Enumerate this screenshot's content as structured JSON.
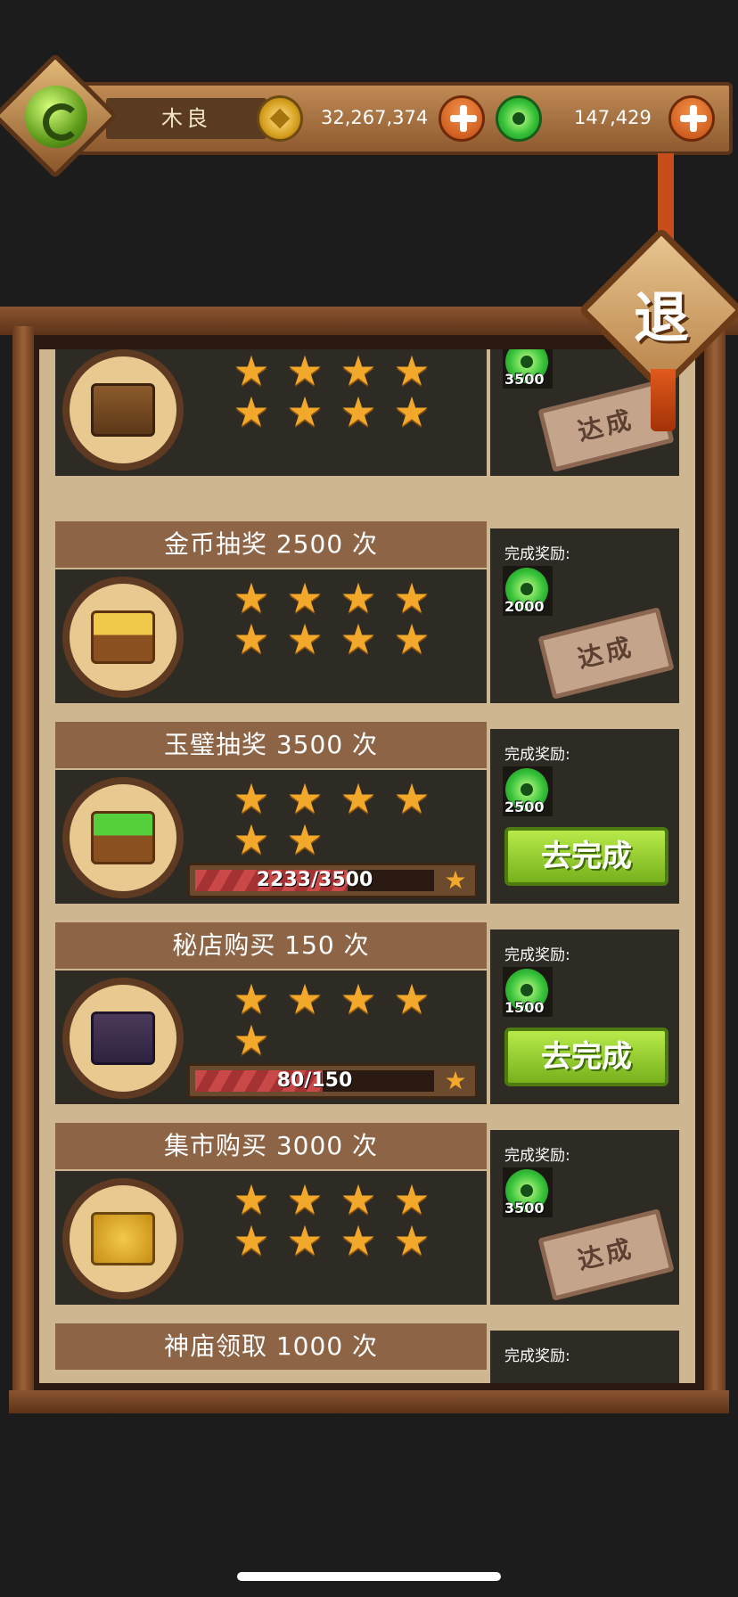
{
  "header": {
    "player_name": "木良",
    "gold": "32,267,374",
    "jade": "147,429"
  },
  "exit_label": "退",
  "tasks": [
    {
      "title": "",
      "stars_earned": 8,
      "stars_total": 8,
      "reward_label": "",
      "reward_amount": "3500",
      "status": "达成",
      "icon": "mahjong-chest-icon"
    },
    {
      "title": "金币抽奖 2500 次",
      "stars_earned": 8,
      "stars_total": 8,
      "reward_label": "完成奖励:",
      "reward_amount": "2000",
      "status": "达成",
      "icon": "gold-chest-icon"
    },
    {
      "title": "玉璧抽奖 3500 次",
      "stars_earned": 6,
      "stars_total": 8,
      "reward_label": "完成奖励:",
      "reward_amount": "2500",
      "progress_text": "2233/3500",
      "progress": 0.638,
      "action": "去完成",
      "icon": "jade-chest-icon"
    },
    {
      "title": "秘店购买 150 次",
      "stars_earned": 5,
      "stars_total": 8,
      "reward_label": "完成奖励:",
      "reward_amount": "1500",
      "progress_text": "80/150",
      "progress": 0.533,
      "action": "去完成",
      "icon": "secret-shop-icon"
    },
    {
      "title": "集市购买 3000 次",
      "stars_earned": 8,
      "stars_total": 8,
      "reward_label": "完成奖励:",
      "reward_amount": "3500",
      "status": "达成",
      "icon": "market-coin-icon"
    },
    {
      "title": "神庙领取 1000 次",
      "reward_label": "完成奖励:"
    }
  ]
}
